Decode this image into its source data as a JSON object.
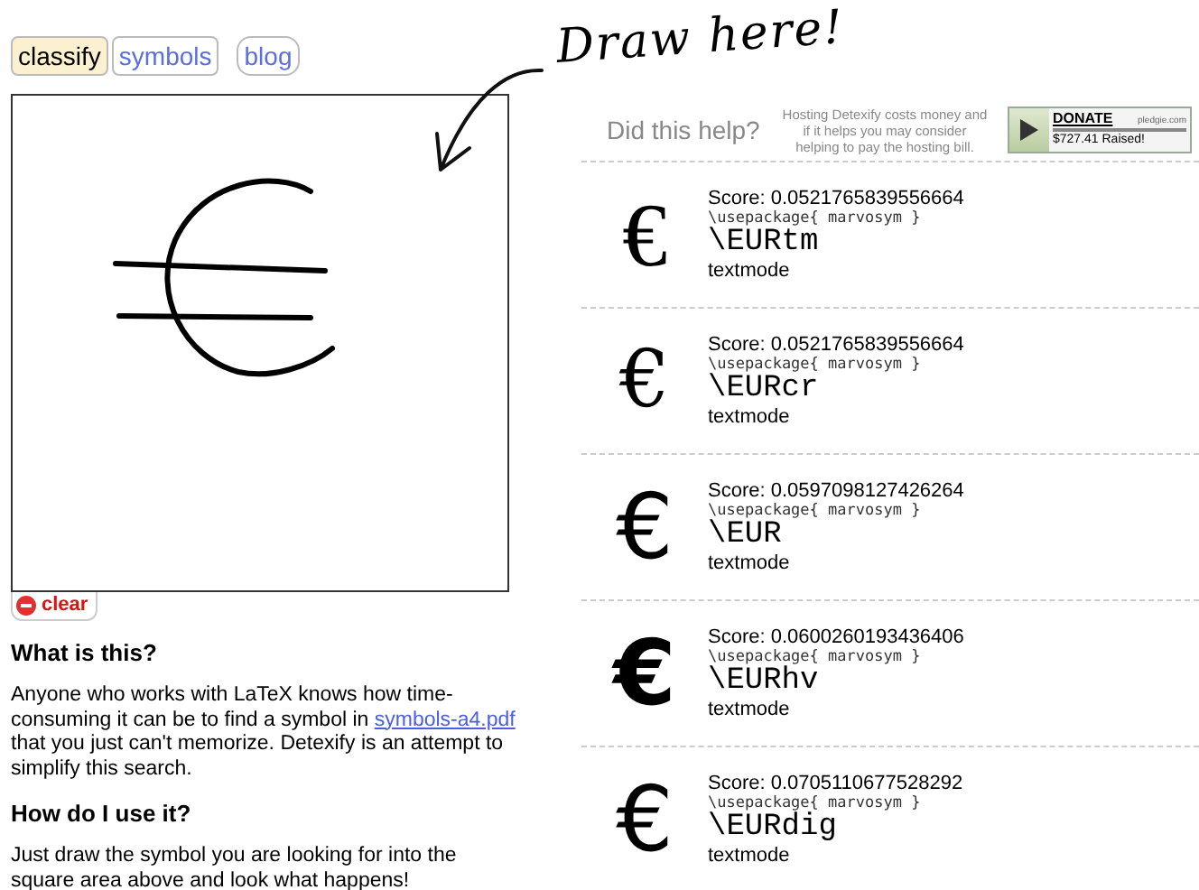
{
  "tabs": [
    {
      "label": "classify",
      "selected": true
    },
    {
      "label": "symbols",
      "selected": false
    },
    {
      "label": "blog",
      "selected": false
    }
  ],
  "annotation": "Draw here!",
  "clear_button": "clear",
  "about": [
    {
      "heading": "What is this?",
      "text_before": "Anyone who works with LaTeX knows how time-consuming it can be to find a symbol in ",
      "link": "symbols-a4.pdf",
      "text_after": " that you just can't memorize. Detexify is an attempt to simplify this search."
    },
    {
      "heading": "How do I use it?",
      "text_before": "Just draw the symbol you are looking for into the square area above and look what happens!"
    }
  ],
  "help": {
    "question": "Did this help?",
    "note": "Hosting Detexify costs money and if it helps you may consider helping to pay the hosting bill.",
    "donate": {
      "label": "DONATE",
      "site": "pledgie.com",
      "raised": "$727.41 Raised!"
    }
  },
  "results": [
    {
      "symbol": "€",
      "kind": "serif",
      "score": "Score: 0.0521765839556664",
      "package": "\\usepackage{ marvosym }",
      "command": "\\EURtm",
      "mode": "textmode"
    },
    {
      "symbol": "€",
      "kind": "thin",
      "score": "Score: 0.0521765839556664",
      "package": "\\usepackage{ marvosym }",
      "command": "\\EURcr",
      "mode": "textmode"
    },
    {
      "symbol": "€",
      "kind": "sans",
      "score": "Score: 0.0597098127426264",
      "package": "\\usepackage{ marvosym }",
      "command": "\\EUR",
      "mode": "textmode"
    },
    {
      "symbol": "€",
      "kind": "bold",
      "score": "Score: 0.0600260193436406",
      "package": "\\usepackage{ marvosym }",
      "command": "\\EURhv",
      "mode": "textmode"
    },
    {
      "symbol": "€",
      "kind": "sans",
      "score": "Score: 0.0705110677528292",
      "package": "\\usepackage{ marvosym }",
      "command": "\\EURdig",
      "mode": "textmode"
    }
  ]
}
